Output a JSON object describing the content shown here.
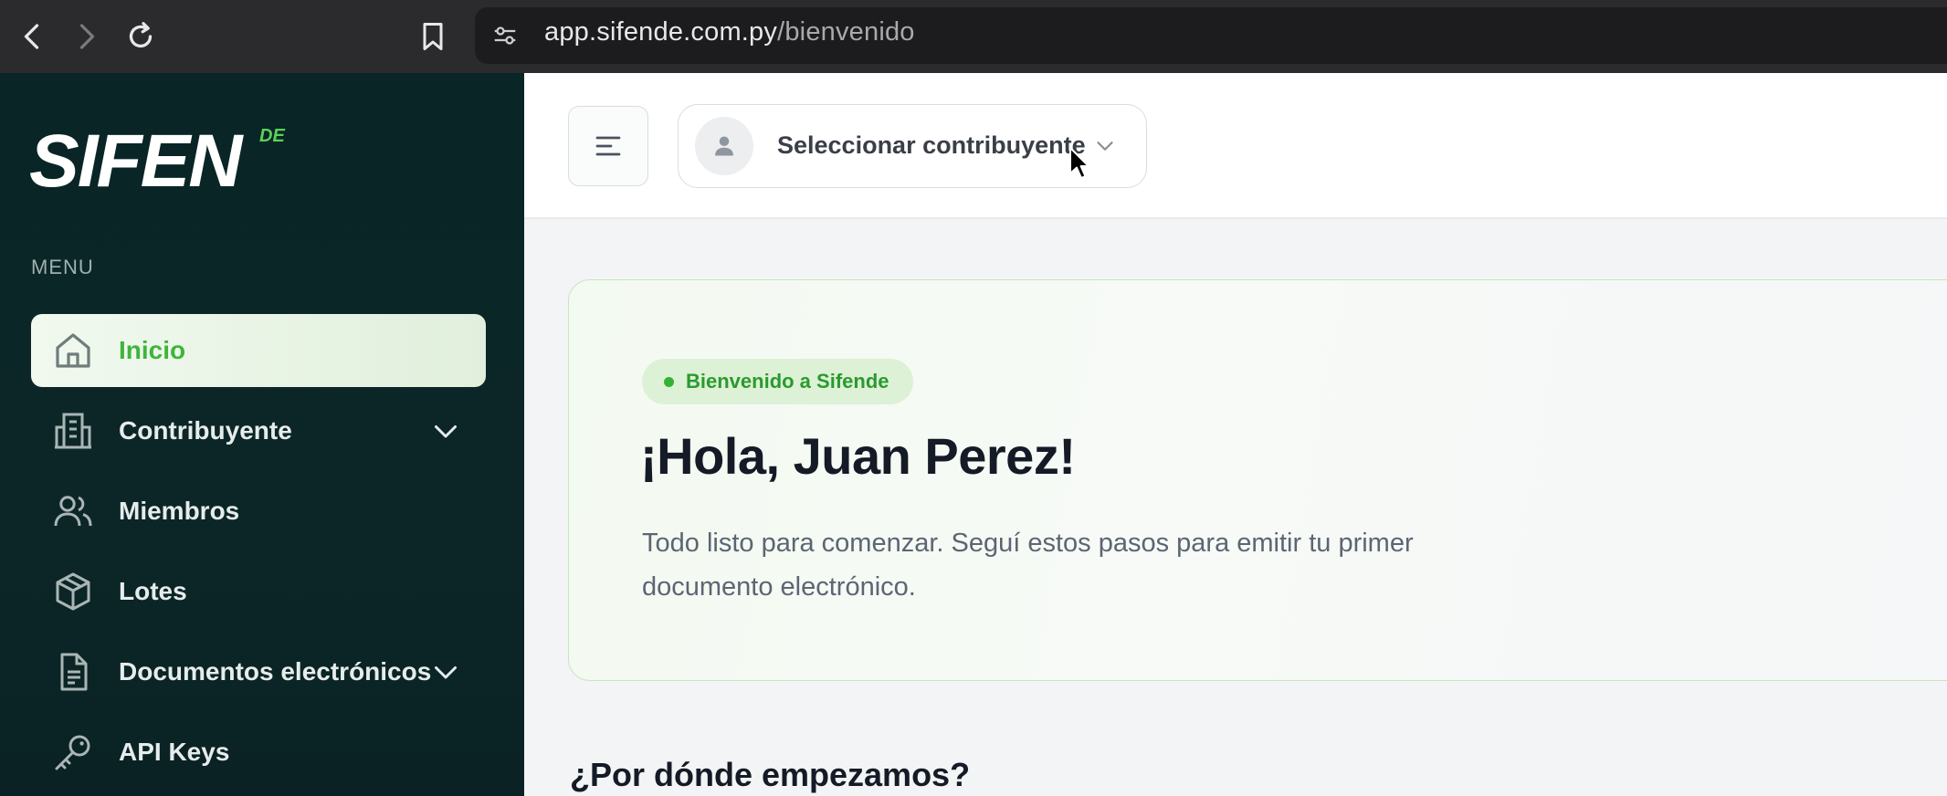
{
  "browser": {
    "url_host": "app.sifende.com.py",
    "url_path": "/bienvenido"
  },
  "sidebar": {
    "logo_text": "SIFEN",
    "logo_sup": "DE",
    "menu_label": "MENU",
    "items": [
      {
        "label": "Inicio",
        "icon": "home-icon",
        "active": true
      },
      {
        "label": "Contribuyente",
        "icon": "building-icon",
        "has_submenu": true
      },
      {
        "label": "Miembros",
        "icon": "users-icon"
      },
      {
        "label": "Lotes",
        "icon": "package-icon"
      },
      {
        "label": "Documentos electrónicos",
        "icon": "document-icon",
        "has_submenu": true
      },
      {
        "label": "API Keys",
        "icon": "key-icon"
      }
    ]
  },
  "header": {
    "contributor_select_label": "Seleccionar contribuyente"
  },
  "welcome": {
    "badge": "Bienvenido a Sifende",
    "greeting": "¡Hola, Juan Perez!",
    "subtitle": "Todo listo para comenzar. Seguí estos pasos para emitir tu primer documento electrónico."
  },
  "section": {
    "title": "¿Por dónde empezamos?"
  },
  "colors": {
    "sidebar_bg": "#0b2526",
    "accent_green": "#3fb43c",
    "active_item_bg": "#e6f3e2"
  }
}
